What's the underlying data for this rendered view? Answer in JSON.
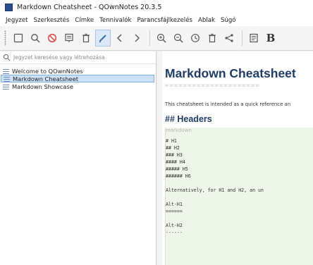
{
  "window": {
    "title": "Markdown Cheatsheet - QOwnNotes 20.3.5"
  },
  "menu": [
    "Jegyzet",
    "Szerkesztés",
    "Címke",
    "Tennivalók",
    "Parancsfájlkezelés",
    "Ablak",
    "Súgó"
  ],
  "toolbar": {
    "icons": [
      "new-note-icon",
      "search-icon",
      "delete-icon",
      "archive-icon",
      "trash-icon",
      "edit-pencil-icon",
      "back-icon",
      "forward-icon",
      "zoom-in-icon",
      "zoom-out-icon",
      "clock-icon",
      "trash-icon",
      "share-icon",
      "outline-icon",
      "bold-icon"
    ],
    "bold_label": "B"
  },
  "search": {
    "placeholder": "Jegyzet keresése vagy létrehozása"
  },
  "notes": [
    {
      "label": "Welcome to QOwnNotes",
      "selected": false
    },
    {
      "label": "Markdown Cheatsheet",
      "selected": true
    },
    {
      "label": "Markdown Showcase",
      "selected": false
    }
  ],
  "editor": {
    "title": "Markdown Cheatsheet",
    "title_underline": "=====================",
    "intro": "This cheatsheet is intended as a quick reference an",
    "h2": "## Headers",
    "code_lang": "markdown",
    "code_lines": [
      "# H1",
      "## H2",
      "### H3",
      "#### H4",
      "##### H5",
      "###### H6",
      "",
      "Alternatively, for H1 and H2, an un",
      "",
      "Alt-H1",
      "======",
      "",
      "Alt-H2",
      "------"
    ]
  }
}
